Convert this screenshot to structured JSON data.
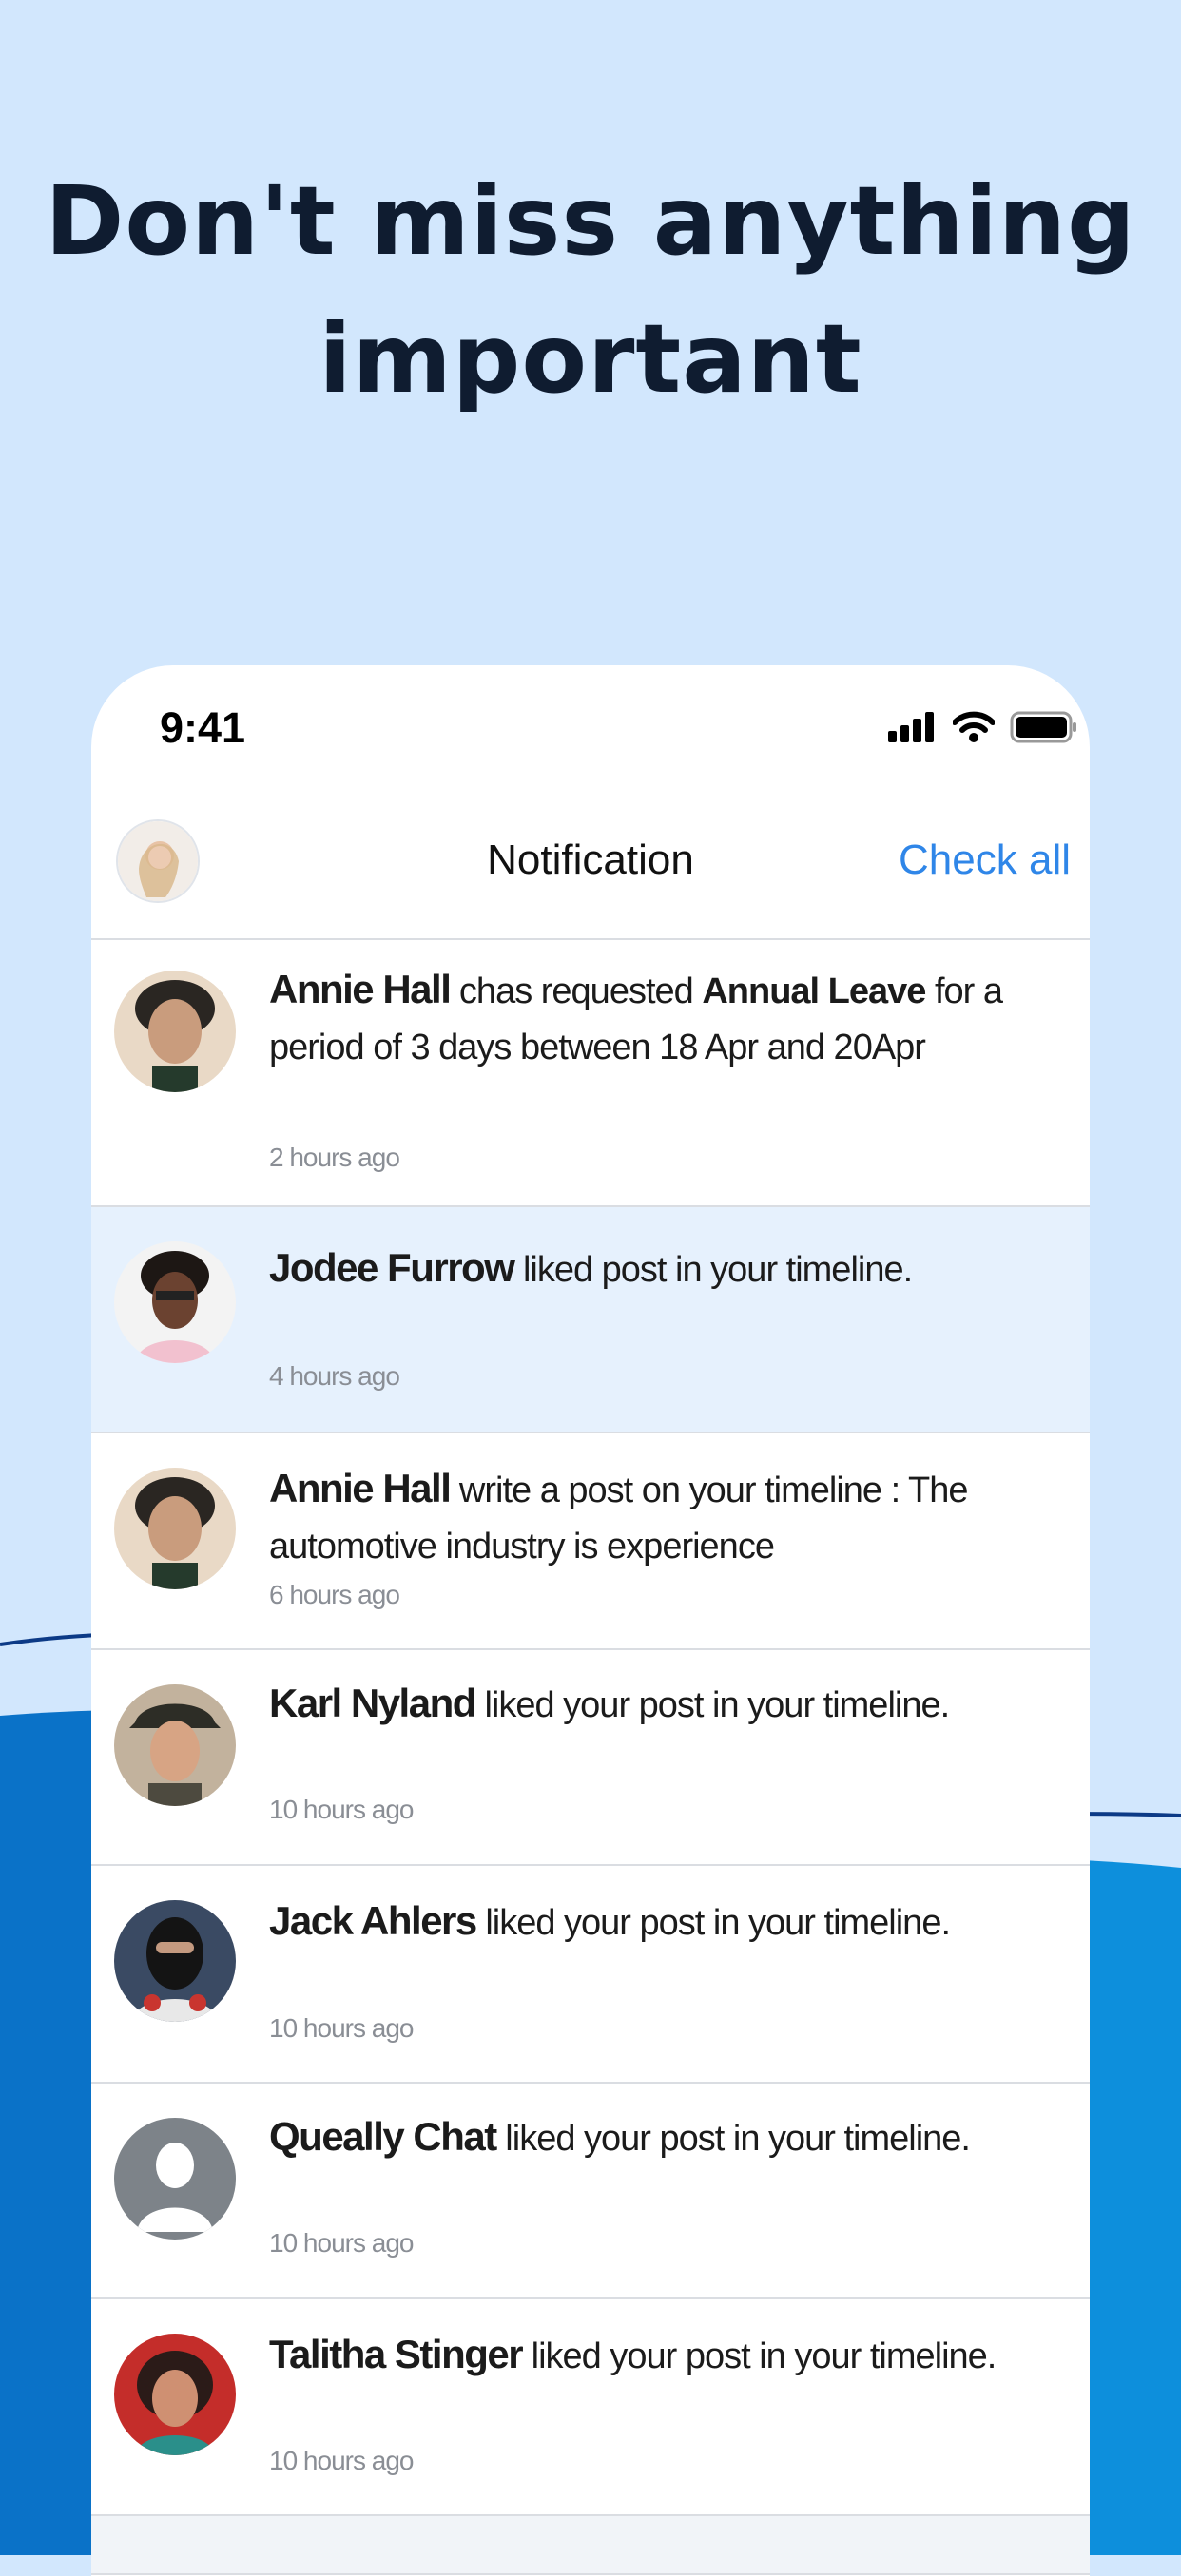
{
  "headline": {
    "line1": "Don't miss anything",
    "line2": "important"
  },
  "status_bar": {
    "time": "9:41"
  },
  "header": {
    "title": "Notification",
    "action_label": "Check all"
  },
  "notifications": [
    {
      "name": "Annie Hall",
      "text_a": " chas requested ",
      "bold": "Annual Leave",
      "text_b": " for a period of 3 days between 18 Apr and 20Apr",
      "time": "2 hours ago"
    },
    {
      "name": "Jodee Furrow",
      "text_a": " liked post in your timeline.",
      "time": "4 hours ago",
      "highlighted": true
    },
    {
      "name": "Annie Hall",
      "text_a": " write a post on your timeline : The automotive industry  is experience",
      "time": "6 hours ago"
    },
    {
      "name": "Karl Nyland",
      "text_a": " liked your post in your timeline.",
      "time": "10 hours ago"
    },
    {
      "name": "Jack Ahlers",
      "text_a": " liked your post in your timeline.",
      "time": "10 hours ago"
    },
    {
      "name": "Queally Chat",
      "text_a": " liked your post in your timeline.",
      "time": "10 hours ago"
    },
    {
      "name": "Talitha Stinger",
      "text_a": " liked your post in your timeline.",
      "time": "10 hours ago"
    }
  ],
  "colors": {
    "background": "#d2e7fd",
    "accent": "#2f86e8",
    "wave": "#0a72c8",
    "highlight_row": "#e6f1fd"
  }
}
